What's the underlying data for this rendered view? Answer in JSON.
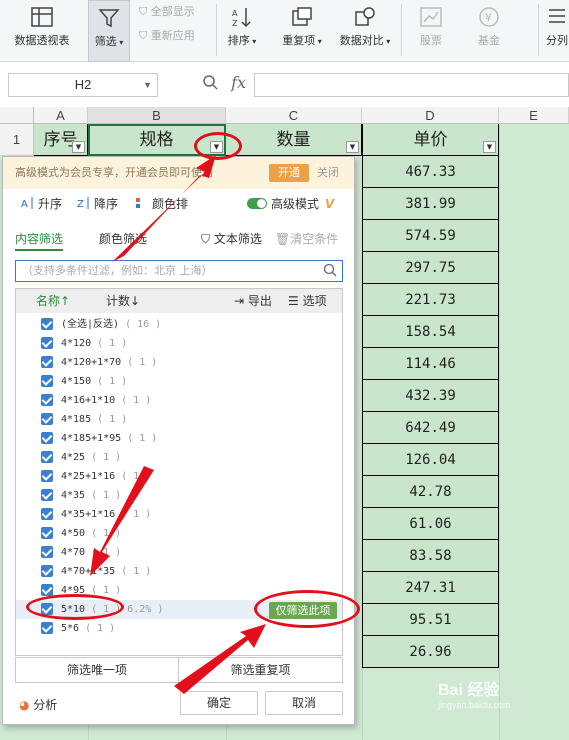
{
  "ribbon": {
    "pivot_label": "数据透视表",
    "filter_label": "筛选",
    "show_all_label": "全部显示",
    "reapply_label": "重新应用",
    "sort_label": "排序",
    "duplicates_label": "重复项",
    "compare_label": "数据对比",
    "stock_label": "股票",
    "fund_label": "基金",
    "split_label": "分列"
  },
  "formula_bar": {
    "name_box": "H2",
    "fx": "fx"
  },
  "columns": [
    "A",
    "B",
    "C",
    "D",
    "E"
  ],
  "rows": [
    "1"
  ],
  "headers": {
    "a": "序号",
    "b": "规格",
    "c": "数量",
    "d": "单价"
  },
  "unit_prices": [
    "467.33",
    "381.99",
    "574.59",
    "297.75",
    "221.73",
    "158.54",
    "114.46",
    "432.39",
    "642.49",
    "126.04",
    "42.78",
    "61.06",
    "83.58",
    "247.31",
    "95.51",
    "26.96"
  ],
  "filter_panel": {
    "banner_text": "高级模式为会员专享，开通会员即可使用",
    "banner_open": "开通",
    "banner_close": "关闭",
    "sort_asc": "升序",
    "sort_desc": "降序",
    "color_sort": "颜色排",
    "advanced_mode": "高级模式",
    "tab_content": "内容筛选",
    "tab_color": "颜色筛选",
    "text_filter": "文本筛选",
    "clear_filter": "清空条件",
    "search_placeholder": "（支持多条件过滤，例如：北京 上海）",
    "col_name": "名称↑",
    "col_count": "计数↓",
    "export": "导出",
    "options": "选项",
    "items": [
      {
        "label": "(全选|反选)",
        "count": "( 16 )"
      },
      {
        "label": "4*120",
        "count": "( 1 )"
      },
      {
        "label": "4*120+1*70",
        "count": "( 1 )"
      },
      {
        "label": "4*150",
        "count": "( 1 )"
      },
      {
        "label": "4*16+1*10",
        "count": "( 1 )"
      },
      {
        "label": "4*185",
        "count": "( 1 )"
      },
      {
        "label": "4*185+1*95",
        "count": "( 1 )"
      },
      {
        "label": "4*25",
        "count": "( 1 )"
      },
      {
        "label": "4*25+1*16",
        "count": "( 1 )"
      },
      {
        "label": "4*35",
        "count": "( 1 )"
      },
      {
        "label": "4*35+1*16",
        "count": "( 1 )"
      },
      {
        "label": "4*50",
        "count": "( 1 )"
      },
      {
        "label": "4*70",
        "count": "( 1 )"
      },
      {
        "label": "4*70+1*35",
        "count": "( 1 )"
      },
      {
        "label": "4*95",
        "count": "( 1 )"
      },
      {
        "label": "5*10",
        "count": "( 1 ) 6.2% )"
      },
      {
        "label": "5*6",
        "count": "( 1 )"
      }
    ],
    "only_this": "仅筛选此项",
    "filter_unique": "筛选唯一项",
    "filter_dup": "筛选重复项",
    "analysis": "分析",
    "ok": "确定",
    "cancel": "取消"
  },
  "watermark": {
    "main": "Bai 经验",
    "sub": "jingyan.baidu.com"
  }
}
